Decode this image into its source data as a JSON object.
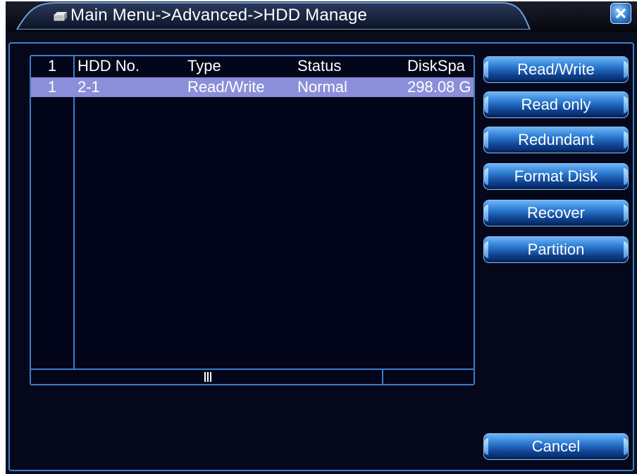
{
  "window": {
    "title": "Main Menu->Advanced->HDD Manage",
    "title_icon": "hdd-folder-icon",
    "close_icon": "close-icon"
  },
  "table": {
    "headers": [
      "1",
      "HDD No.",
      "Type",
      "Status",
      "DiskSpa"
    ],
    "rows": [
      [
        "1",
        "2-1",
        "Read/Write",
        "Normal",
        "298.08 G"
      ]
    ],
    "selected_row": 0,
    "scroll_grip_icon": "scroll-grip-icon"
  },
  "buttons": {
    "read_write": "Read/Write",
    "read_only": "Read only",
    "redundant": "Redundant",
    "format_disk": "Format Disk",
    "recover": "Recover",
    "partition": "Partition",
    "cancel": "Cancel"
  },
  "colors": {
    "accent": "#3e7cc4",
    "selected_row": "#8b8fd9",
    "button": "#2f7fd6",
    "background": "#05081a"
  }
}
